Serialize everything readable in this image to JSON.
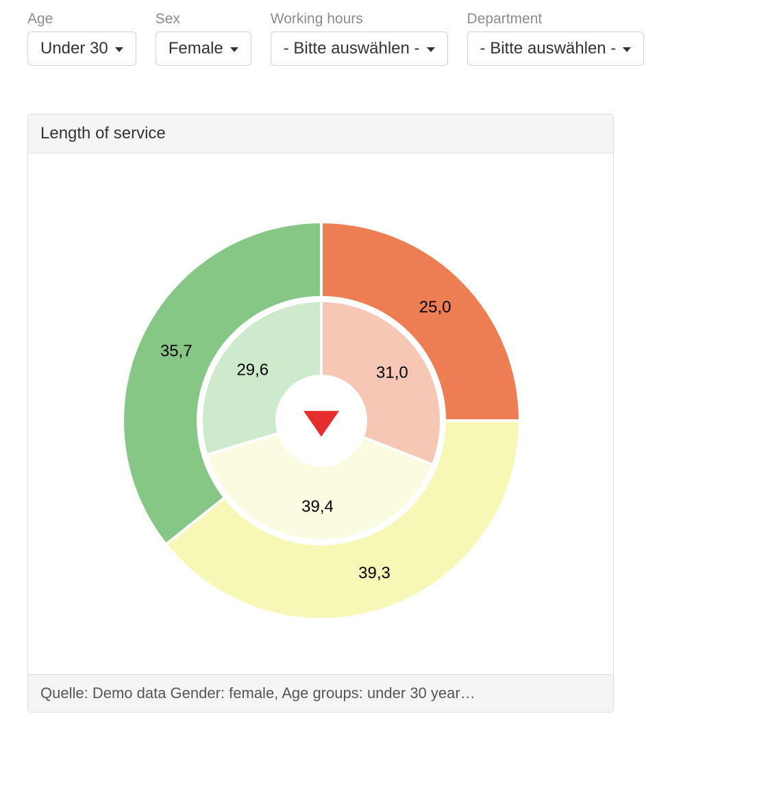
{
  "filters": [
    {
      "label": "Age",
      "value": "Under 30"
    },
    {
      "label": "Sex",
      "value": "Female"
    },
    {
      "label": "Working hours",
      "value": "- Bitte auswählen -"
    },
    {
      "label": "Department",
      "value": "- Bitte auswählen -"
    }
  ],
  "panel": {
    "title": "Length of service",
    "footer": "Quelle: Demo data Gender: female, Age groups: under 30 year…"
  },
  "chart_data": {
    "type": "pie",
    "title": "Length of service",
    "rings": [
      {
        "name": "outer",
        "slices": [
          {
            "label": "25,0",
            "value": 25.0,
            "color": "#ed7d53"
          },
          {
            "label": "39,3",
            "value": 39.3,
            "color": "#f7f7b6"
          },
          {
            "label": "35,7",
            "value": 35.7,
            "color": "#86c785"
          }
        ]
      },
      {
        "name": "inner",
        "slices": [
          {
            "label": "31,0",
            "value": 31.0,
            "color": "#f6c7b4"
          },
          {
            "label": "39,4",
            "value": 39.4,
            "color": "#fbfbe1"
          },
          {
            "label": "29,6",
            "value": 29.6,
            "color": "#ceeacc"
          }
        ]
      }
    ],
    "center_indicator": "down",
    "center_indicator_color": "#e62e2e"
  }
}
